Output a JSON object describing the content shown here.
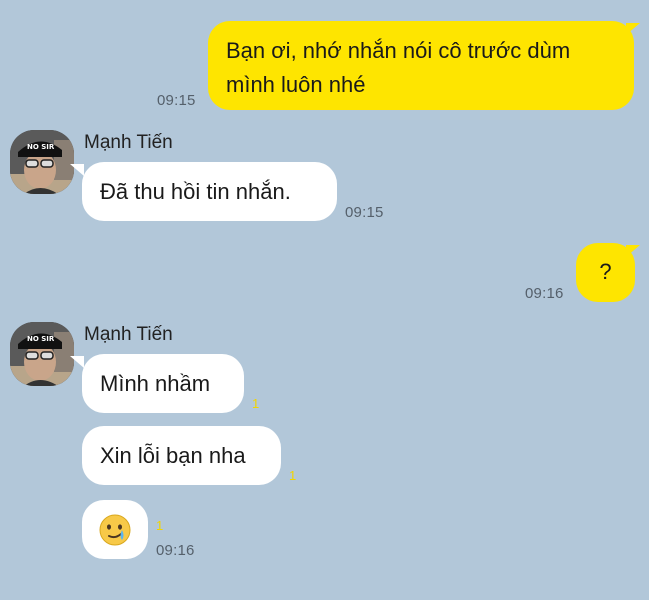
{
  "messages": [
    {
      "type": "out",
      "lines": [
        "Bạn ơi, nhớ nhắn nói cô trước dùm",
        "mình luôn nhé"
      ],
      "time": "09:15"
    },
    {
      "type": "in",
      "sender": "Mạnh Tiến",
      "text": "Đã thu hồi tin nhắn.",
      "time": "09:15"
    },
    {
      "type": "out",
      "text": "?",
      "time": "09:16"
    },
    {
      "type": "in",
      "sender": "Mạnh Tiến",
      "text": "Mình nhầm",
      "unread": "1"
    },
    {
      "type": "in",
      "text": "Xin lỗi bạn nha",
      "unread": "1"
    },
    {
      "type": "in",
      "emoji": "tearful-smile-emoji",
      "unread": "1",
      "time": "09:16"
    }
  ],
  "avatar": {
    "cap_text": "NO SIR"
  },
  "colors": {
    "background": "#b2c7d9",
    "outgoing_bubble": "#fee500",
    "incoming_bubble": "#ffffff",
    "unread_count": "#f1d500"
  }
}
